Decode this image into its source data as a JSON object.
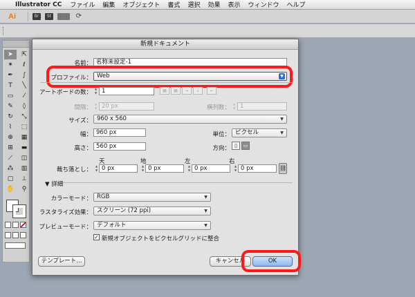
{
  "menubar": {
    "app_name": "Illustrator CC",
    "items": [
      "ファイル",
      "編集",
      "オブジェクト",
      "書式",
      "選択",
      "効果",
      "表示",
      "ウィンドウ",
      "ヘルプ"
    ]
  },
  "appbar": {
    "logo": "Ai",
    "bridge": "Br",
    "stock": "St"
  },
  "dialog": {
    "title": "新規ドキュメント",
    "name_label": "名前：",
    "name_value": "名称未設定-1",
    "profile_label": "プロファイル：",
    "profile_value": "Web",
    "artboards_label": "アートボードの数：",
    "artboards_value": "1",
    "spacing_label": "間隔：",
    "spacing_value": "20 px",
    "columns_label": "横列数：",
    "columns_value": "1",
    "size_label": "サイズ：",
    "size_value": "960 x 560",
    "width_label": "幅：",
    "width_value": "960 px",
    "units_label": "単位：",
    "units_value": "ピクセル",
    "height_label": "高さ：",
    "height_value": "560 px",
    "orientation_label": "方向：",
    "bleed_label": "裁ち落とし：",
    "bleed": {
      "top_label": "天",
      "bottom_label": "地",
      "left_label": "左",
      "right_label": "右",
      "top": "0 px",
      "bottom": "0 px",
      "left": "0 px",
      "right": "0 px"
    },
    "advanced_label": "詳細",
    "color_mode_label": "カラーモード：",
    "color_mode_value": "RGB",
    "raster_label": "ラスタライズ効果：",
    "raster_value": "スクリーン (72 ppi)",
    "preview_label": "プレビューモード：",
    "preview_value": "デフォルト",
    "align_pixel_label": "新規オブジェクトをピクセルグリッドに整合",
    "align_pixel_checked": true,
    "template_button": "テンプレート...",
    "cancel_button": "キャンセル",
    "ok_button": "OK"
  },
  "highlight_color": "#ff1a1a"
}
